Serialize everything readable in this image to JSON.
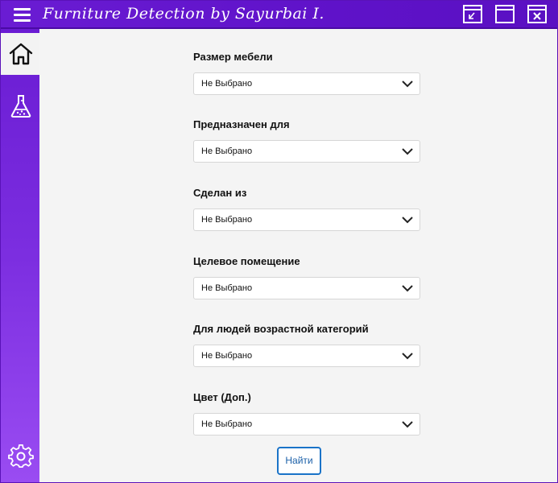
{
  "window": {
    "title": "Furniture Detection by Sayurbai I."
  },
  "sidebar": {
    "items": [
      {
        "name": "home",
        "icon": "home-icon",
        "active": true
      },
      {
        "name": "lab",
        "icon": "flask-icon",
        "active": false
      },
      {
        "name": "settings",
        "icon": "gear-icon",
        "active": false
      }
    ]
  },
  "form": {
    "fields": [
      {
        "label": "Размер мебели",
        "value": "Не Выбрано"
      },
      {
        "label": "Предназначен для",
        "value": "Не Выбрано"
      },
      {
        "label": "Сделан из",
        "value": "Не Выбрано"
      },
      {
        "label": "Целевое помещение",
        "value": "Не Выбрано"
      },
      {
        "label": "Для людей возрастной категорий",
        "value": "Не Выбрано"
      },
      {
        "label": "Цвет (Доп.)",
        "value": "Не Выбрано"
      }
    ],
    "submit_label": "Найти"
  },
  "colors": {
    "accent": "#6a1cd3",
    "button_border": "#1a73c8"
  }
}
